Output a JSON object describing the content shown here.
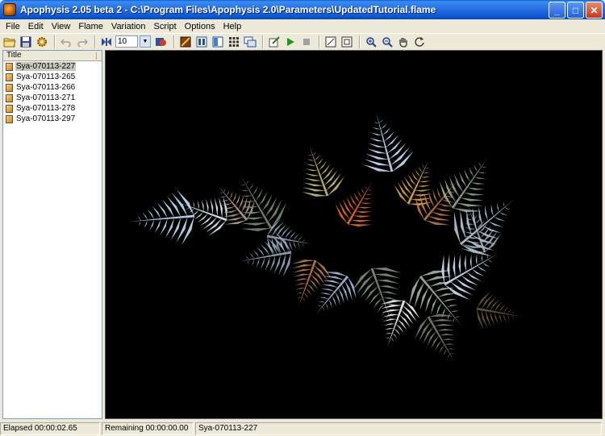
{
  "window": {
    "title": "Apophysis 2.05 beta 2 - C:\\Program Files\\Apophysis 2.0\\Parameters\\UpdatedTutorial.flame",
    "minimize": "_",
    "maximize": "□",
    "close": "✕"
  },
  "menu": [
    "File",
    "Edit",
    "View",
    "Flame",
    "Variation",
    "Script",
    "Options",
    "Help"
  ],
  "toolbar": {
    "zoom_value": "10",
    "icons": [
      "open-icon",
      "save-icon",
      "gear-icon",
      "undo-icon",
      "redo-icon",
      "fullscreen-icon",
      "render-icon",
      "edit-icon",
      "adjust-icon",
      "gradient-icon",
      "mutate-icon",
      "browse-icon",
      "script-edit-icon",
      "play-icon",
      "stop-icon",
      "view-icon",
      "fit-icon",
      "zoom-in-icon",
      "zoom-out-icon",
      "hand-icon",
      "rotate-icon"
    ]
  },
  "list": {
    "header": "Title",
    "items": [
      "Sya-070113-227",
      "Sya-070113-265",
      "Sya-070113-266",
      "Sya-070113-271",
      "Sya-070113-278",
      "Sya-070113-297"
    ],
    "selected_index": 0
  },
  "status": {
    "elapsed": "Elapsed 00:00:02.65",
    "remaining": "Remaining 00:00:00.00",
    "flame_name": "Sya-070113-227"
  },
  "colors": {
    "canvas_bg": "#000000",
    "titlebar": "#2a73e5"
  }
}
